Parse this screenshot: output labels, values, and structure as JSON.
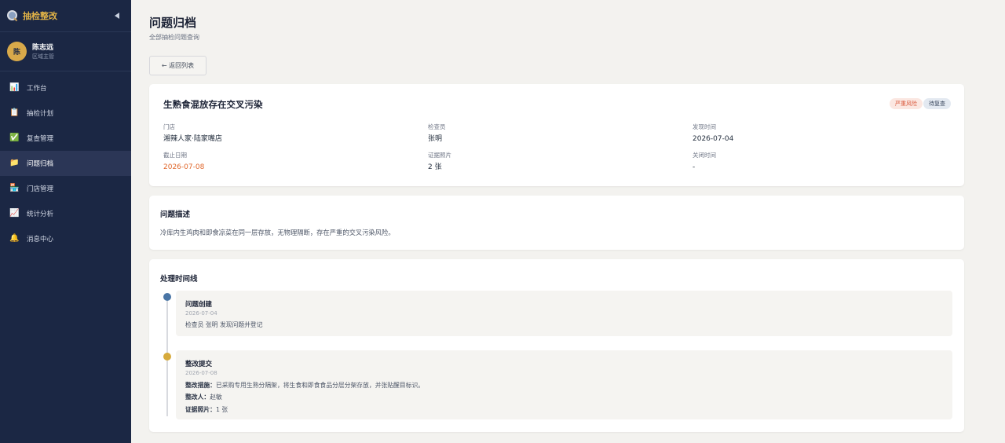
{
  "app": {
    "title": "抽检整改"
  },
  "user": {
    "avatar_char": "陈",
    "name": "陈志远",
    "role": "区域主管"
  },
  "nav": [
    {
      "label": "工作台",
      "icon": "chart-icon",
      "glyph": "📊",
      "active": false
    },
    {
      "label": "抽检计划",
      "icon": "clipboard-icon",
      "glyph": "📋",
      "active": false
    },
    {
      "label": "复查管理",
      "icon": "check-icon",
      "glyph": "✅",
      "active": false
    },
    {
      "label": "问题归档",
      "icon": "folder-icon",
      "glyph": "📁",
      "active": true
    },
    {
      "label": "门店管理",
      "icon": "store-icon",
      "glyph": "🏪",
      "active": false
    },
    {
      "label": "统计分析",
      "icon": "trend-icon",
      "glyph": "📈",
      "active": false
    },
    {
      "label": "消息中心",
      "icon": "bell-icon",
      "glyph": "🔔",
      "active": false
    }
  ],
  "page": {
    "title": "问题归档",
    "subtitle": "全部抽检问题查询",
    "back_label": "← 返回列表"
  },
  "issue": {
    "title": "生熟食混放存在交叉污染",
    "risk_badge": "严重风险",
    "status_badge": "待复查",
    "fields": {
      "store_label": "门店",
      "store_value": "湘辣人家·陆家嘴店",
      "inspector_label": "检查员",
      "inspector_value": "张明",
      "found_label": "发现时间",
      "found_value": "2026-07-04",
      "deadline_label": "截止日期",
      "deadline_value": "2026-07-08",
      "photos_label": "证据照片",
      "photos_value": "2 张",
      "closed_label": "关闭时间",
      "closed_value": "-"
    }
  },
  "description": {
    "title": "问题描述",
    "text": "冷库内生鸡肉和即食凉菜在同一层存放，无物理隔断，存在严重的交叉污染风险。"
  },
  "timeline": {
    "title": "处理时间线",
    "events": [
      {
        "title": "问题创建",
        "date": "2026-07-04",
        "line1": "检查员 张明 发现问题并登记"
      },
      {
        "title": "整改提交",
        "date": "2026-07-08",
        "measure_label": "整改措施：",
        "measure_value": "已采购专用生熟分隔架，将生食和即食食品分层分架存放，并张贴醒目标识。",
        "person_label": "整改人：",
        "person_value": "赵敏",
        "photos_label": "证据照片：",
        "photos_value": "1 张"
      }
    ]
  },
  "colors": {
    "sidebar": "#1b2744",
    "accent": "#e3b447",
    "risk": "#d9573a",
    "deadline": "#e0672c"
  }
}
